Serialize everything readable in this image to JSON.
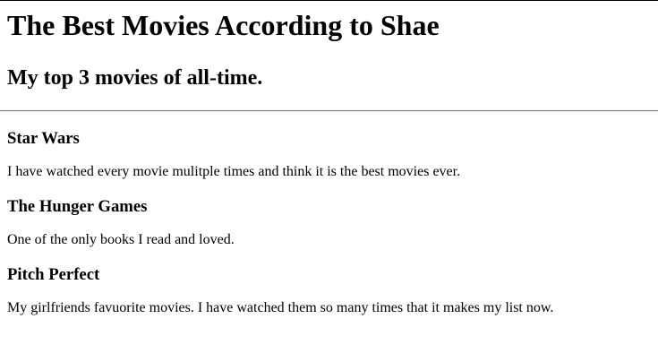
{
  "page": {
    "title": "The Best Movies According to Shae",
    "subtitle": "My top 3 movies of all-time."
  },
  "movies": [
    {
      "title": "Star Wars",
      "description": "I have watched every movie mulitple times and think it is the best movies ever."
    },
    {
      "title": "The Hunger Games",
      "description": "One of the only books I read and loved."
    },
    {
      "title": "Pitch Perfect",
      "description": "My girlfriends favuorite movies. I have watched them so many times that it makes my list now."
    }
  ]
}
